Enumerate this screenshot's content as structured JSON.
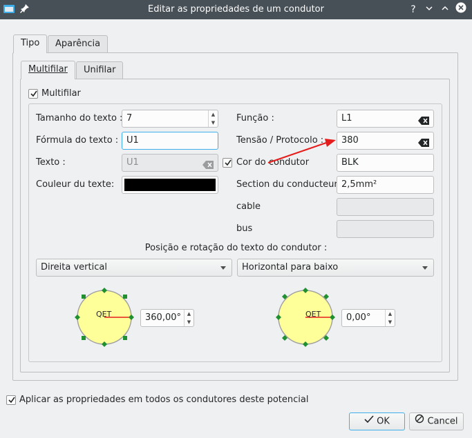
{
  "window": {
    "title": "Editar as propriedades de um condutor"
  },
  "tabs": {
    "tipo": "Tipo",
    "aparencia": "Aparência"
  },
  "subtabs": {
    "multifilar": "Multifilar",
    "unifilar": "Unifilar"
  },
  "multifilar_checkbox": {
    "label": "Multifilar",
    "checked": true
  },
  "fields": {
    "text_size": {
      "label": "Tamanho do texto :",
      "value": "7"
    },
    "text_formula": {
      "label": "Fórmula do texto :",
      "value": "U1"
    },
    "text": {
      "label": "Texto :",
      "value": "U1"
    },
    "text_color": {
      "label": "Couleur du texte:"
    },
    "function": {
      "label": "Função :",
      "value": "L1"
    },
    "voltage": {
      "label": "Tensão / Protocolo :",
      "value": "380"
    },
    "wire_color": {
      "label": "Cor do condutor",
      "value": "BLK",
      "checked": true
    },
    "section": {
      "label": "Section du conducteur",
      "value": "2,5mm²"
    },
    "cable": {
      "label": "cable",
      "value": ""
    },
    "bus": {
      "label": "bus",
      "value": ""
    }
  },
  "position": {
    "heading": "Posição e rotação do texto do condutor :",
    "combo_left": "Direita vertical",
    "combo_right": "Horizontal para baixo",
    "dial_left": {
      "text": "QET",
      "angle": "360,00°"
    },
    "dial_right": {
      "text": "QET",
      "angle": "0,00°"
    }
  },
  "apply_all": {
    "label": "Aplicar as propriedades em todos os condutores deste potencial",
    "checked": true
  },
  "buttons": {
    "ok": "OK",
    "cancel": "Cancel"
  },
  "colors": {
    "titlebar": "#475057",
    "accent": "#3daee9",
    "dial_fill": "#ffff99",
    "dial_node": "#1f8f2f",
    "arrow": "#e51c1c"
  }
}
